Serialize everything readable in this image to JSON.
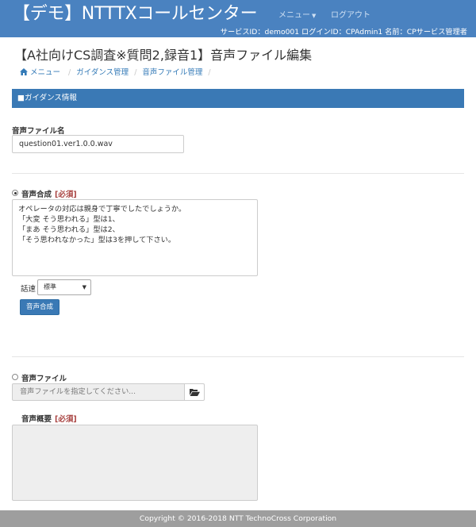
{
  "header": {
    "brand": "【デモ】NTTTXコールセンター",
    "nav_menu": "メニュー",
    "nav_logout": "ログアウト",
    "user_info": "サービスID：demo001 ログインID：CPAdmin1 名前：CPサービス管理者"
  },
  "page": {
    "title": "【A社向けCS調査※質問2,録音1】音声ファイル編集"
  },
  "breadcrumb": {
    "items": [
      "メニュー",
      "ガイダンス管理",
      "音声ファイル管理"
    ],
    "home_icon": "home-icon"
  },
  "section": {
    "title": "■ガイダンス情報"
  },
  "form": {
    "file_name_label": "音声ファイル名",
    "file_name_value": "question01.ver1.0.0.wav",
    "tts_label": "音声合成",
    "required_mark": "[必須]",
    "tts_selected": true,
    "tts_lines": [
      "オペレータの対応は親身で丁寧でしたでしょうか。",
      "「大変 そう思われる」型は1、",
      "「まあ そう思われる」型は2、",
      "「そう思われなかった」型は3を押して下さい。"
    ],
    "speed_label": "話速",
    "speed_value": "標準",
    "synthesize_button": "音声合成",
    "audio_file_label": "音声ファイル",
    "audio_file_selected": false,
    "audio_file_placeholder": "音声ファイルを指定してください...",
    "folder_icon": "folder-open-icon",
    "summary_label": "音声概要",
    "summary_value": ""
  },
  "footer": {
    "copyright": "Copyright © 2016-2018 NTT TechnoCross Corporation"
  },
  "colors": {
    "header_bg": "#4a82c0",
    "section_bar": "#3a79b5",
    "required": "#a94442",
    "footer_bg": "#9e9e9e"
  }
}
